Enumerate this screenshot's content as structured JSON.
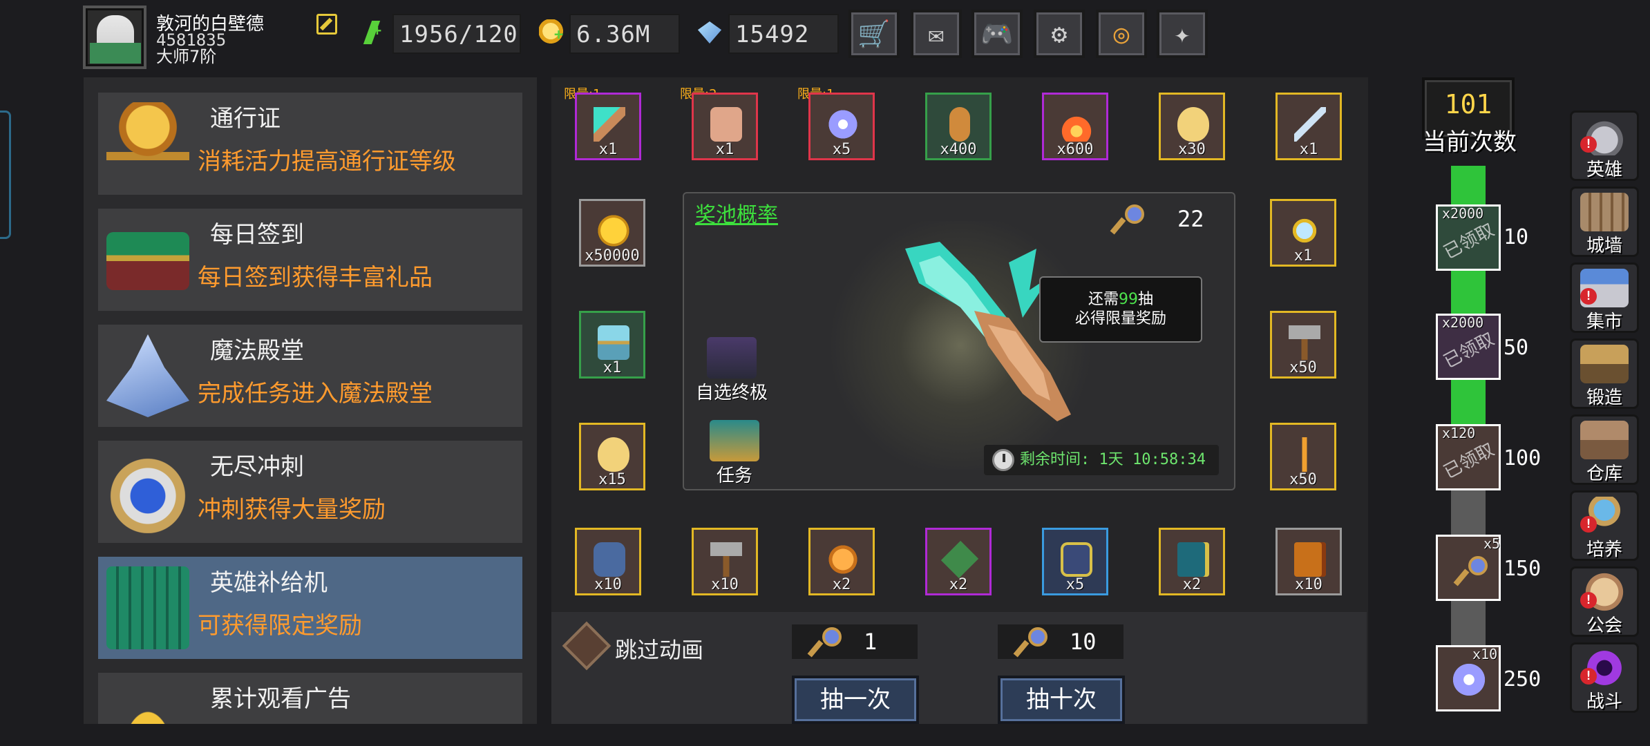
{
  "player": {
    "name": "敦河的白壁德",
    "id": "4581835",
    "rank": "大师7阶"
  },
  "resources": {
    "energy": "1956/120",
    "gold": "6.36M",
    "gems": "15492"
  },
  "top_buttons": [
    {
      "icon": "shop-cart-icon",
      "glyph": "🛒"
    },
    {
      "icon": "mail-icon",
      "glyph": "✉"
    },
    {
      "icon": "gamepad-icon",
      "glyph": "🎮"
    },
    {
      "icon": "gear-icon",
      "glyph": "⚙"
    },
    {
      "icon": "color-wheel-icon",
      "glyph": "◎"
    },
    {
      "icon": "firework-icon",
      "glyph": "✦"
    }
  ],
  "menu": [
    {
      "title": "通行证",
      "desc": "消耗活力提高通行证等级"
    },
    {
      "title": "每日签到",
      "desc": "每日签到获得丰富礼品"
    },
    {
      "title": "魔法殿堂",
      "desc": "完成任务进入魔法殿堂"
    },
    {
      "title": "无尽冲刺",
      "desc": "冲刺获得大量奖励"
    },
    {
      "title": "英雄补给机",
      "desc": "可获得限定奖励"
    },
    {
      "title": "累计观看广告",
      "desc": ""
    }
  ],
  "limit_labels": [
    "限量:1",
    "限量:2",
    "限量:1"
  ],
  "items_top": [
    "x1",
    "x1",
    "x5",
    "x400",
    "x600",
    "x30",
    "x1"
  ],
  "items_left": [
    "x50000",
    "x1",
    "x15"
  ],
  "items_right": [
    "x1",
    "x50",
    "x50"
  ],
  "items_bottom": [
    "x10",
    "x10",
    "x2",
    "x2",
    "x5",
    "x2",
    "x10"
  ],
  "pool": {
    "title": "奖池概率",
    "key_count": "22",
    "tip_prefix": "还需",
    "tip_num": "99",
    "tip_suffix": "抽",
    "tip_line2": "必得限量奖励",
    "timer": "剩余时间: 1天 10:58:34",
    "side_top_label": "自选终极",
    "side_bottom_label": "任务"
  },
  "bottom": {
    "skip_label": "跳过动画",
    "cost_one": "1",
    "cost_ten": "10",
    "draw_one": "抽一次",
    "draw_ten": "抽十次"
  },
  "progress": {
    "current": "101",
    "current_label": "当前次数",
    "milestones": [
      {
        "count": "x2000",
        "threshold": "10",
        "claimed_label": "已领取"
      },
      {
        "count": "x2000",
        "threshold": "50",
        "claimed_label": "已领取"
      },
      {
        "count": "x120",
        "threshold": "100",
        "claimed_label": "已领取"
      },
      {
        "count": "x5",
        "threshold": "150",
        "claimed_label": ""
      },
      {
        "count": "x10",
        "threshold": "250",
        "claimed_label": ""
      }
    ]
  },
  "right_nav": [
    {
      "label": "英雄",
      "badge": "!"
    },
    {
      "label": "城墙",
      "badge": ""
    },
    {
      "label": "集市",
      "badge": "!"
    },
    {
      "label": "锻造",
      "badge": ""
    },
    {
      "label": "仓库",
      "badge": ""
    },
    {
      "label": "培养",
      "badge": "!"
    },
    {
      "label": "公会",
      "badge": "!"
    },
    {
      "label": "战斗",
      "badge": "!"
    }
  ],
  "colors": {
    "accent_orange": "#ff9b2e",
    "green_text": "#3de03d",
    "active_menu": "#4f6886",
    "gold_text": "#ffd54a"
  }
}
